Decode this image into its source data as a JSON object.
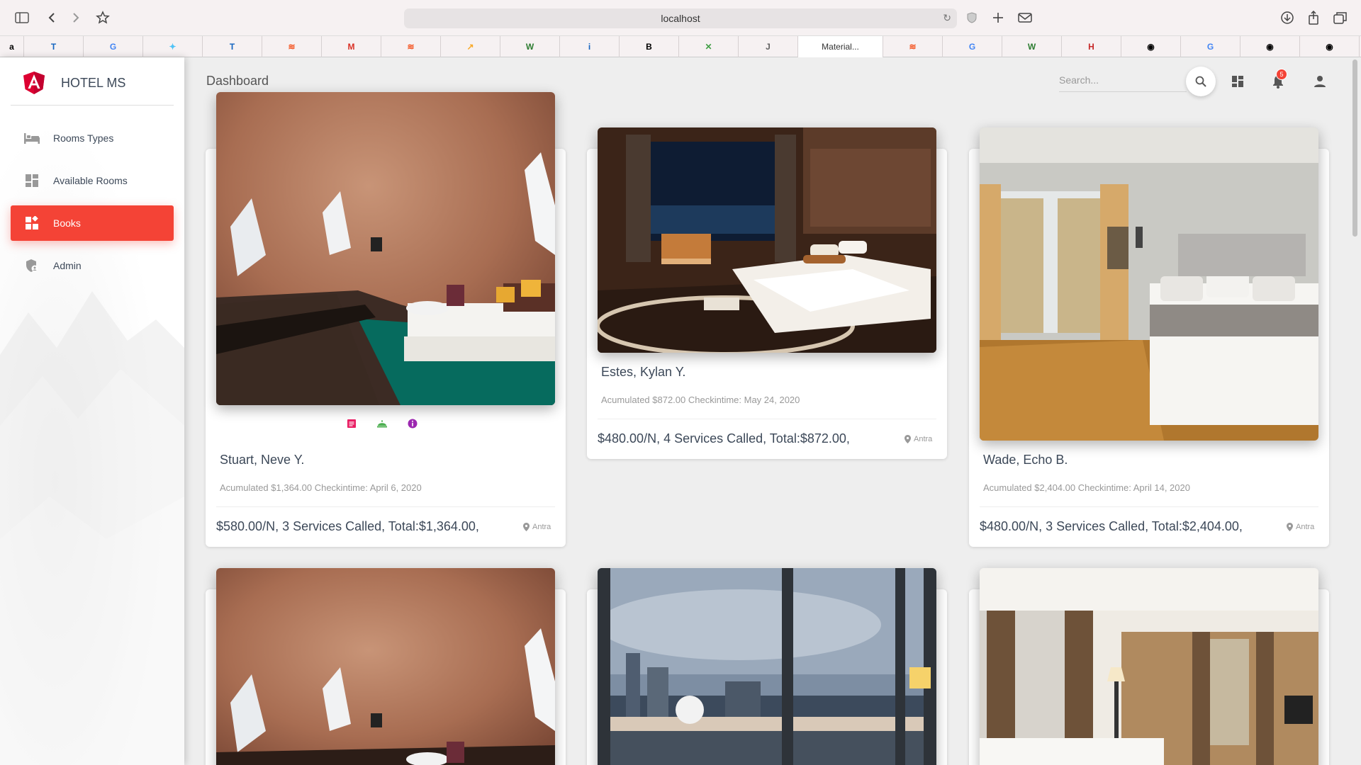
{
  "browser": {
    "url": "localhost",
    "active_tab_label": "Material..."
  },
  "bookmarks": [
    {
      "glyph": "a",
      "color": "#000000"
    },
    {
      "glyph": "T",
      "color": "#1565c0"
    },
    {
      "glyph": "G",
      "color": "#4285f4"
    },
    {
      "glyph": "✦",
      "color": "#4fc3f7"
    },
    {
      "glyph": "T",
      "color": "#1565c0"
    },
    {
      "glyph": "≋",
      "color": "#f4511e"
    },
    {
      "glyph": "M",
      "color": "#d93025"
    },
    {
      "glyph": "≋",
      "color": "#f4511e"
    },
    {
      "glyph": "↗",
      "color": "#f9a825"
    },
    {
      "glyph": "W",
      "color": "#2e7d32"
    },
    {
      "glyph": "i",
      "color": "#1565c0"
    },
    {
      "glyph": "B",
      "color": "#000000"
    },
    {
      "glyph": "✕",
      "color": "#43a047"
    },
    {
      "glyph": "J",
      "color": "#616161"
    },
    {
      "glyph": "Material...",
      "color": "#333333"
    },
    {
      "glyph": "≋",
      "color": "#f4511e"
    },
    {
      "glyph": "G",
      "color": "#4285f4"
    },
    {
      "glyph": "W",
      "color": "#2e7d32"
    },
    {
      "glyph": "H",
      "color": "#c62828"
    },
    {
      "glyph": "◉",
      "color": "#000000"
    },
    {
      "glyph": "G",
      "color": "#4285f4"
    },
    {
      "glyph": "◉",
      "color": "#000000"
    },
    {
      "glyph": "◉",
      "color": "#000000"
    }
  ],
  "sidebar": {
    "brand": "HOTEL MS",
    "items": [
      {
        "label": "Rooms Types",
        "icon": "bed-icon"
      },
      {
        "label": "Available Rooms",
        "icon": "dashboard-icon"
      },
      {
        "label": "Books",
        "icon": "widgets-icon",
        "active": true
      },
      {
        "label": "Admin",
        "icon": "admin-shield-icon"
      }
    ]
  },
  "header": {
    "title": "Dashboard",
    "search_placeholder": "Search...",
    "notification_count": "5"
  },
  "colors": {
    "accent": "#f44336",
    "action_pink": "#e91e63",
    "action_green": "#4caf50",
    "action_purple": "#9c27b0"
  },
  "cards": [
    {
      "name": "Stuart, Neve Y.",
      "details": "Acumulated $1,364.00 Checkintime: April 6, 2020",
      "price": "$580.00/N, 3 Services Called, Total:$1,364.00,",
      "location": "Antra"
    },
    {
      "name": "Estes, Kylan Y.",
      "details": "Acumulated $872.00 Checkintime: May 24, 2020",
      "price": "$480.00/N, 4 Services Called, Total:$872.00,",
      "location": "Antra"
    },
    {
      "name": "Wade, Echo B.",
      "details": "Acumulated $2,404.00 Checkintime: April 14, 2020",
      "price": "$480.00/N, 3 Services Called, Total:$2,404.00,",
      "location": "Antra"
    }
  ]
}
